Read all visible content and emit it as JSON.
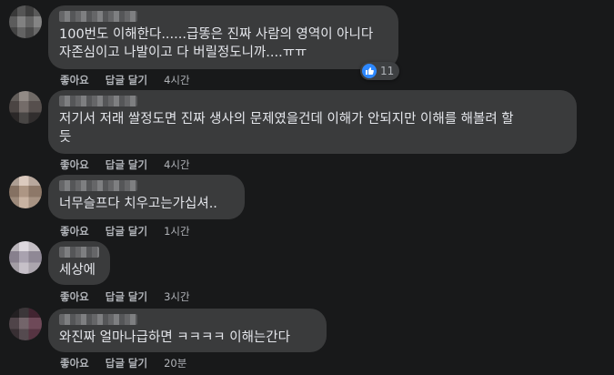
{
  "comments": [
    {
      "text": "100번도 이해한다......급똥은 진짜 사람의 영역이 아니다\n자존심이고 나발이고 다 버릴정도니까....ㅠㅠ",
      "like": "좋아요",
      "reply": "답글 달기",
      "time": "4시간",
      "reaction_count": "11"
    },
    {
      "text": "저기서 저래 쌀정도면 진짜 생사의 문제였을건데 이해가 안되지만 이해를 해볼려 할\n듯",
      "like": "좋아요",
      "reply": "답글 달기",
      "time": "4시간"
    },
    {
      "text": "너무슬프다 치우고는가십셔..",
      "like": "좋아요",
      "reply": "답글 달기",
      "time": "1시간"
    },
    {
      "text": "세상에",
      "like": "좋아요",
      "reply": "답글 달기",
      "time": "3시간"
    },
    {
      "text": "와진짜 얼마나급하면 ㅋㅋㅋㅋ 이해는간다",
      "like": "좋아요",
      "reply": "답글 달기",
      "time": "20분"
    }
  ],
  "colors": {
    "background": "#18191a",
    "bubble": "#3a3b3c",
    "text": "#e4e6eb",
    "secondary_text": "#b0b3b8",
    "like_blue": "#2d88ff"
  },
  "icons": {
    "reaction": "thumbs-up-icon"
  }
}
